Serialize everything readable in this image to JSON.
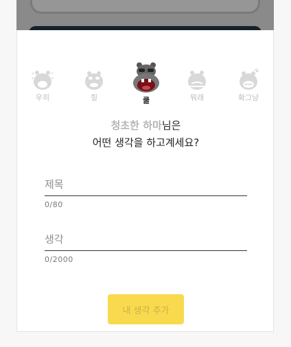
{
  "moods": [
    {
      "label": "우히",
      "icon": "happy-hippo-icon",
      "active": false
    },
    {
      "label": "힝",
      "icon": "crying-hippo-icon",
      "active": false
    },
    {
      "label": "쿨",
      "icon": "cool-hippo-icon",
      "active": true
    },
    {
      "label": "뭐래",
      "icon": "skeptical-hippo-icon",
      "active": false
    },
    {
      "label": "확그냥",
      "icon": "angry-hippo-icon",
      "active": false
    }
  ],
  "question": {
    "nickname": "청초한 하마",
    "suffix": "님은",
    "line2": "어떤 생각을 하고계세요?"
  },
  "title_field": {
    "placeholder": "제목",
    "counter": "0/80"
  },
  "thought_field": {
    "placeholder": "생각",
    "counter": "0/2000"
  },
  "submit_label": "내 생각 추가",
  "colors": {
    "accent": "#f9da4f",
    "submit_text": "#c9b04a",
    "inactive": "#bdbdbd"
  }
}
